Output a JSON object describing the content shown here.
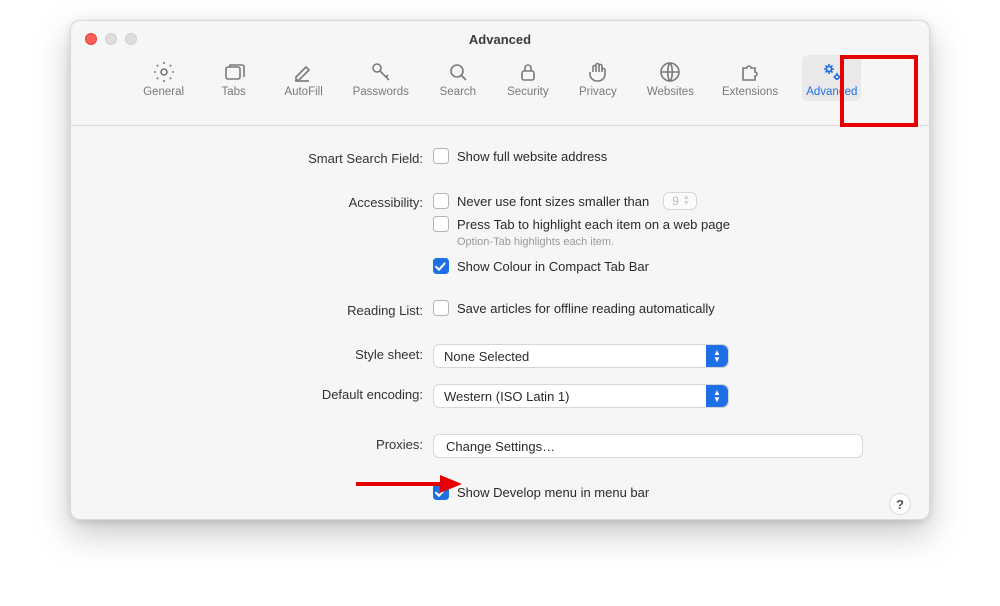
{
  "window_title": "Advanced",
  "toolbar": {
    "items": [
      {
        "key": "general",
        "label": "General"
      },
      {
        "key": "tabs",
        "label": "Tabs"
      },
      {
        "key": "autofill",
        "label": "AutoFill"
      },
      {
        "key": "passwords",
        "label": "Passwords"
      },
      {
        "key": "search",
        "label": "Search"
      },
      {
        "key": "security",
        "label": "Security"
      },
      {
        "key": "privacy",
        "label": "Privacy"
      },
      {
        "key": "websites",
        "label": "Websites"
      },
      {
        "key": "extensions",
        "label": "Extensions"
      },
      {
        "key": "advanced",
        "label": "Advanced"
      }
    ],
    "active_key": "advanced"
  },
  "sections": {
    "smart_search": {
      "label": "Smart Search Field:",
      "show_full_address": {
        "label": "Show full website address",
        "checked": false
      }
    },
    "accessibility": {
      "label": "Accessibility:",
      "never_smaller": {
        "label": "Never use font sizes smaller than",
        "value": "9",
        "checked": false
      },
      "press_tab": {
        "label": "Press Tab to highlight each item on a web page",
        "checked": false
      },
      "hint": "Option-Tab highlights each item.",
      "show_colour": {
        "label": "Show Colour in Compact Tab Bar",
        "checked": true
      }
    },
    "reading_list": {
      "label": "Reading List:",
      "save_offline": {
        "label": "Save articles for offline reading automatically",
        "checked": false
      }
    },
    "style_sheet": {
      "label": "Style sheet:",
      "value": "None Selected"
    },
    "default_encoding": {
      "label": "Default encoding:",
      "value": "Western (ISO Latin 1)"
    },
    "proxies": {
      "label": "Proxies:",
      "button": "Change Settings…"
    },
    "develop": {
      "label": "",
      "show_develop": {
        "label": "Show Develop menu in menu bar",
        "checked": true
      }
    }
  },
  "help_label": "?"
}
